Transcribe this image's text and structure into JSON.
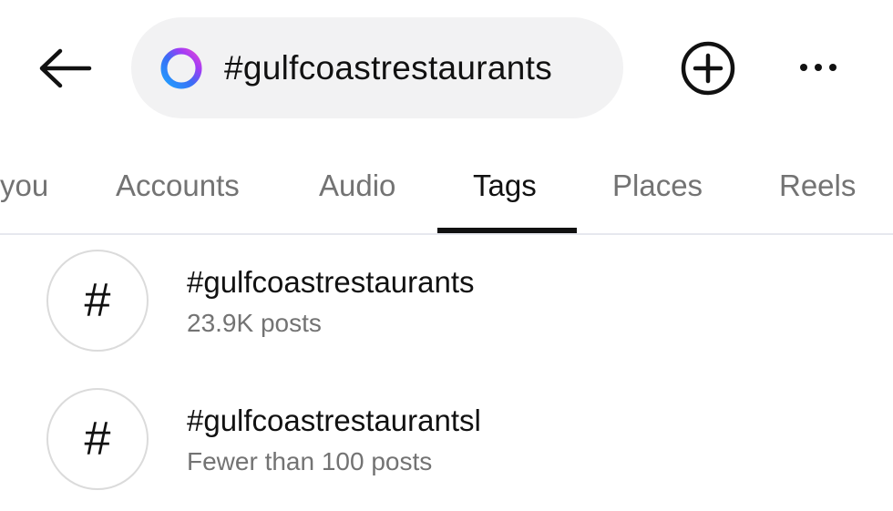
{
  "header": {
    "search": {
      "value": "#gulfcoastrestaurants"
    },
    "icons": {
      "back": "arrow-left-icon",
      "meta_ai": "meta-ai-ring-icon",
      "create": "plus-circle-icon",
      "more": "more-horizontal-icon"
    }
  },
  "tabs": {
    "items": [
      {
        "label": "you"
      },
      {
        "label": "Accounts"
      },
      {
        "label": "Audio"
      },
      {
        "label": "Tags"
      },
      {
        "label": "Places"
      },
      {
        "label": "Reels"
      }
    ],
    "active": "Tags"
  },
  "results": [
    {
      "title": "#gulfcoastrestaurants",
      "subtitle": "23.9K posts",
      "icon_text": "#"
    },
    {
      "title": "#gulfcoastrestaurantsl",
      "subtitle": "Fewer than 100 posts",
      "icon_text": "#"
    }
  ],
  "colors": {
    "text_primary": "#111111",
    "text_secondary": "#737373",
    "search_bg": "#f2f2f3",
    "indicator": "#111111",
    "divider": "#e6e8ee"
  }
}
